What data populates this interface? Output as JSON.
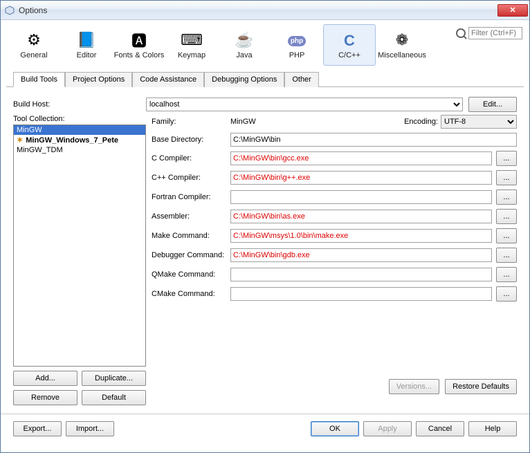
{
  "window": {
    "title": "Options"
  },
  "toolbar": {
    "items": [
      {
        "label": "General",
        "icon": "⚙"
      },
      {
        "label": "Editor",
        "icon": "📘"
      },
      {
        "label": "Fonts & Colors",
        "icon": "🅰"
      },
      {
        "label": "Keymap",
        "icon": "⌨"
      },
      {
        "label": "Java",
        "icon": "☕"
      },
      {
        "label": "PHP",
        "icon": "php"
      },
      {
        "label": "C/C++",
        "icon": "C"
      },
      {
        "label": "Miscellaneous",
        "icon": "❁"
      }
    ],
    "selected_index": 6,
    "filter_placeholder": "Filter (Ctrl+F)"
  },
  "tabs": {
    "items": [
      "Build Tools",
      "Project Options",
      "Code Assistance",
      "Debugging Options",
      "Other"
    ],
    "active_index": 0
  },
  "build": {
    "host_label": "Build Host:",
    "host_value": "localhost",
    "edit_button": "Edit...",
    "tool_collection_label": "Tool Collection:",
    "tools": [
      {
        "name": "MinGW",
        "selected": true,
        "bold": false,
        "icon": ""
      },
      {
        "name": "MinGW_Windows_7_Pete",
        "selected": false,
        "bold": true,
        "icon": "✶"
      },
      {
        "name": "MinGW_TDM",
        "selected": false,
        "bold": false,
        "icon": ""
      }
    ],
    "leftbuttons": {
      "add": "Add...",
      "duplicate": "Duplicate...",
      "remove": "Remove",
      "default": "Default"
    },
    "family_label": "Family:",
    "family_value": "MinGW",
    "encoding_label": "Encoding:",
    "encoding_value": "UTF-8",
    "fields": [
      {
        "label": "Base Directory:",
        "value": "C:\\MinGW\\bin",
        "red": false,
        "browse": false
      },
      {
        "label": "C Compiler:",
        "value": "C:\\MinGW\\bin\\gcc.exe",
        "red": true,
        "browse": true
      },
      {
        "label": "C++ Compiler:",
        "value": "C:\\MinGW\\bin\\g++.exe",
        "red": true,
        "browse": true
      },
      {
        "label": "Fortran Compiler:",
        "value": "",
        "red": false,
        "browse": true
      },
      {
        "label": "Assembler:",
        "value": "C:\\MinGW\\bin\\as.exe",
        "red": true,
        "browse": true
      },
      {
        "label": "Make Command:",
        "value": "C:\\MinGW\\msys\\1.0\\bin\\make.exe",
        "red": true,
        "browse": true
      },
      {
        "label": "Debugger Command:",
        "value": "C:\\MinGW\\bin\\gdb.exe",
        "red": true,
        "browse": true
      },
      {
        "label": "QMake Command:",
        "value": "",
        "red": false,
        "browse": true
      },
      {
        "label": "CMake Command:",
        "value": "",
        "red": false,
        "browse": true
      }
    ],
    "versions_button": "Versions...",
    "restore_button": "Restore Defaults"
  },
  "footer": {
    "export": "Export...",
    "import": "Import...",
    "ok": "OK",
    "apply": "Apply",
    "cancel": "Cancel",
    "help": "Help"
  }
}
